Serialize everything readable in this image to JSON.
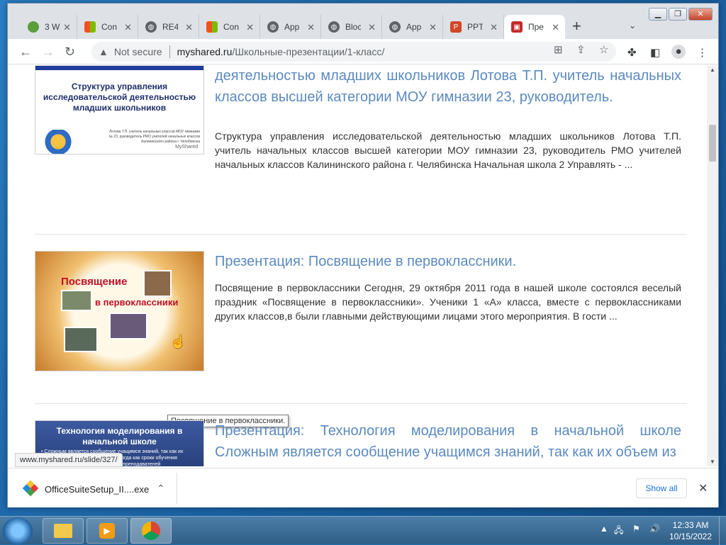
{
  "browser": {
    "tabs": [
      {
        "title": "3 W",
        "icon": "green-app-icon",
        "color": "#5a9e3a"
      },
      {
        "title": "Con",
        "icon": "microsoft-icon",
        "color": "#f25022"
      },
      {
        "title": "RE4",
        "icon": "globe-icon",
        "color": "#5f6368"
      },
      {
        "title": "Con",
        "icon": "microsoft-icon",
        "color": "#f25022"
      },
      {
        "title": "App",
        "icon": "globe-icon",
        "color": "#5f6368"
      },
      {
        "title": "Bloc",
        "icon": "globe-icon",
        "color": "#5f6368"
      },
      {
        "title": "App",
        "icon": "globe-icon",
        "color": "#5f6368"
      },
      {
        "title": "PPT",
        "icon": "ppt-icon",
        "color": "#d24726"
      },
      {
        "title": "Пре",
        "icon": "presentation-icon",
        "color": "#c62828"
      }
    ],
    "new_tab": "+",
    "not_secure": "Not secure",
    "url_host": "myshared.ru",
    "url_path": "/Школьные-презентации/1-класс/"
  },
  "results": [
    {
      "title": "Презентация: Структура управления исследовательской деятельностью младших школьников Лотова Т.П. учитель начальных классов высшей категории МОУ гимназии 23, руководитель.",
      "description": "Структура управления исследовательской деятельностью младших школьников Лотова Т.П. учитель начальных классов высшей категории МОУ гимназии 23, руководитель РМО учителей начальных классов Калининского района г. Челябинска Начальная школа 2 Управлять - ...",
      "thumb_title": "Структура управления исследовательской деятельностью младших школьников",
      "thumb_meta": "Лотова Т.П. учитель начальных классов МОУ гимназии № 23, руководитель РМО учителей начальных классов Калининского района г. Челябинска",
      "thumb_brand": "MyShared"
    },
    {
      "title": "Презентация: Посвящение в первоклассники.",
      "description": "Посвящение в первоклассники Сегодня, 29 октября 2011 года в нашей школе состоялся веселый праздник «Посвящение в первоклассники». Ученики 1 «А» класса, вместе с первоклассниками других классов,в были главными действующими лицами этого мероприятия. В гости ...",
      "thumb_line1": "Посвящение",
      "thumb_line2": "в первоклассники"
    },
    {
      "title": "Презентация: Технология моделирования в начальной школе Сложным является сообщение учащимся знаний, так как их объем из",
      "thumb_title": "Технология моделирования в начальной школе",
      "thumb_text": "• Сложным является сообщение учащимся знаний, так как их объем постоянно увеличивается, тогда как сроки обучения остаются неизменными. В помощь преподавателей"
    }
  ],
  "tooltip": "Посвящение в первоклассники.",
  "status_url": "www.myshared.ru/slide/327/",
  "download": {
    "filename": "OfficeSuiteSetup_II....exe",
    "show_all": "Show all"
  },
  "taskbar": {
    "time": "12:33 AM",
    "date": "10/15/2022"
  }
}
